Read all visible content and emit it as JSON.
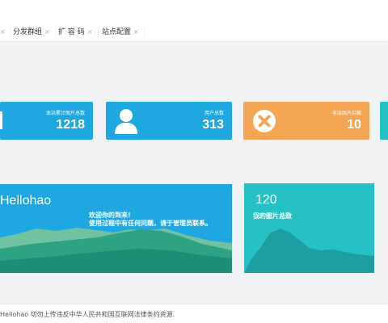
{
  "tabs": [
    {
      "label": "分发群组",
      "close": "×"
    },
    {
      "label": "扩 容 码",
      "close": "×"
    },
    {
      "label": "站点配置",
      "close": "×"
    }
  ],
  "cards": [
    {
      "label": "本站累计图片总数",
      "value": "1218",
      "color": "#1ea7e1",
      "icon": "image-icon"
    },
    {
      "label": "用户总数",
      "value": "313",
      "color": "#1ea7e1",
      "icon": "user-icon"
    },
    {
      "label": "非法图片拦截",
      "value": "10",
      "color": "#f5a654",
      "icon": "block-icon"
    }
  ],
  "hero": {
    "name": "Hellohao",
    "welcome": "欢迎你的到来!",
    "message": "使用过程中有任何问题，请于管理员联系。"
  },
  "teal_card": {
    "value": "120",
    "label": "我的图片总数"
  },
  "footer": {
    "text": "Hellohao 切勿上传违反中华人民共和国互联网法律条约资源."
  }
}
